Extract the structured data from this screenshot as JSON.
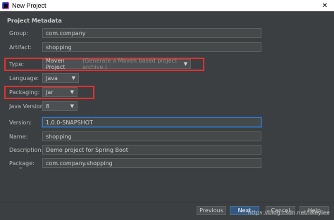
{
  "window": {
    "title": "New Project",
    "close_glyph": "✕"
  },
  "section": {
    "title": "Project Metadata"
  },
  "fields": {
    "group": {
      "label": "Group:",
      "value": "com.company"
    },
    "artifact": {
      "label": "Artifact:",
      "value": "shopping"
    },
    "type": {
      "label": "Type:",
      "value": "Maven Project",
      "hint": "(Generate a Maven based project archive.)"
    },
    "language": {
      "label": "Language:",
      "value": "Java"
    },
    "packaging": {
      "label": "Packaging:",
      "value": "Jar"
    },
    "java_version": {
      "label": "Java Version:",
      "value": "8"
    },
    "version": {
      "label": "Version:",
      "value": "1.0.0-SNAPSHOT"
    },
    "name": {
      "label": "Name:",
      "value": "shopping"
    },
    "description": {
      "label": "Description:",
      "value": "Demo project for Spring Boot"
    },
    "package": {
      "label": "Package:",
      "value": "com.company.shopping"
    }
  },
  "buttons": {
    "previous": "Previous",
    "next": "Next",
    "cancel": "Cancel",
    "help": "Help"
  },
  "watermark": "https://blog.csdn.net/likeyiee",
  "colors": {
    "highlight": "#e03030",
    "primary": "#365880",
    "background": "#3c3f41"
  }
}
